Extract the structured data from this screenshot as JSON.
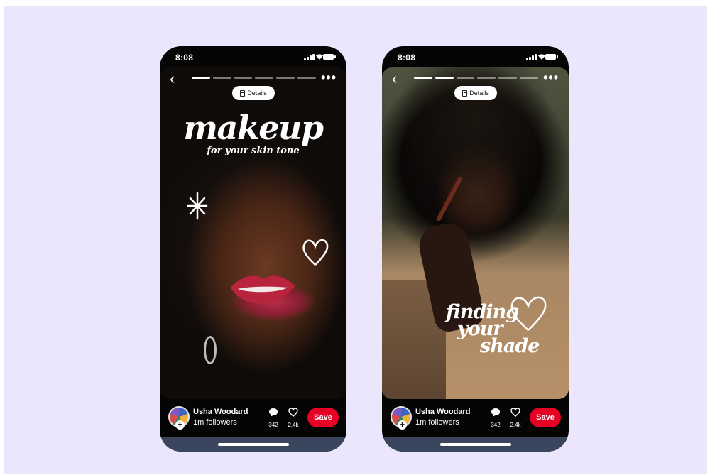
{
  "phones": [
    {
      "status_time": "8:08",
      "details_label": "Details",
      "title": "makeup",
      "subtitle": "for your skin tone",
      "user_name": "Usha Woodard",
      "followers": "1m followers",
      "comments": "342",
      "likes": "2.4k",
      "save_label": "Save",
      "progress_current": 1,
      "progress_total": 6
    },
    {
      "status_time": "8:08",
      "details_label": "Details",
      "title_lines": [
        "finding",
        "your",
        "shade"
      ],
      "user_name": "Usha Woodard",
      "followers": "1m followers",
      "comments": "342",
      "likes": "2.4k",
      "save_label": "Save",
      "progress_current": 2,
      "progress_total": 6
    }
  ],
  "colors": {
    "background": "#ebe6fb",
    "save_button": "#e60023",
    "phone_frame": "#050505"
  },
  "icons": [
    "back-chevron-icon",
    "more-dots-icon",
    "details-doc-icon",
    "comment-icon",
    "heart-icon",
    "plus-icon",
    "signal-icon",
    "wifi-icon",
    "battery-icon"
  ]
}
